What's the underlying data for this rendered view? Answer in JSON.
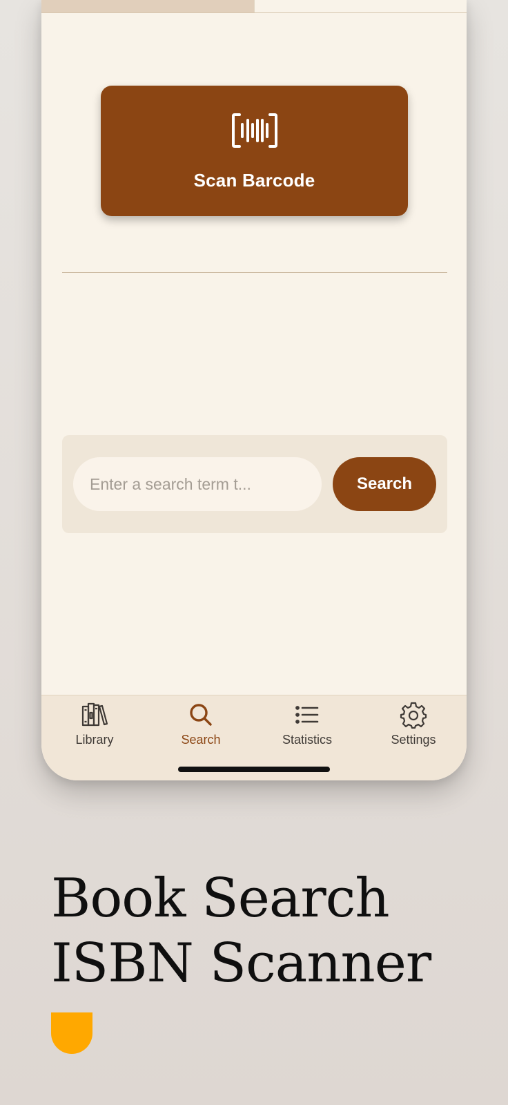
{
  "scan": {
    "label": "Scan Barcode",
    "icon": "barcode-scan-icon"
  },
  "search": {
    "placeholder": "Enter a search term t...",
    "value": "",
    "button_label": "Search"
  },
  "tabs": [
    {
      "label": "Library",
      "icon": "books-icon",
      "active": false
    },
    {
      "label": "Search",
      "icon": "magnifier-icon",
      "active": true
    },
    {
      "label": "Statistics",
      "icon": "list-icon",
      "active": false
    },
    {
      "label": "Settings",
      "icon": "gear-icon",
      "active": false
    }
  ],
  "headline": {
    "line1": "Book Search",
    "line2": "ISBN Scanner"
  },
  "colors": {
    "brand_brown": "#8b4513",
    "background": "#f9f3e9",
    "accent_yellow": "#ffa800"
  }
}
